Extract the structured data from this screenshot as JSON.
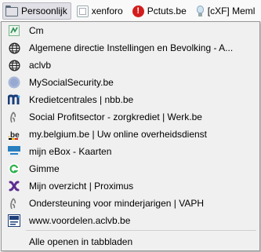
{
  "toolbar": {
    "items": [
      {
        "label": "Persoonlijk",
        "icon": "folder-icon",
        "active": true
      },
      {
        "label": "xenforo",
        "icon": "folder-icon"
      },
      {
        "label": "Pctuts.be",
        "icon": "pctuts-icon"
      },
      {
        "label": "[cXF] Meml",
        "icon": "bulb-icon"
      }
    ]
  },
  "menu": {
    "items": [
      {
        "label": "Cm",
        "icon": "cm-icon"
      },
      {
        "label": "Algemene directie Instellingen en Bevolking -  A...",
        "icon": "globe-icon"
      },
      {
        "label": "aclvb",
        "icon": "globe-icon"
      },
      {
        "label": "MySocialSecurity.be",
        "icon": "mysocialsecurity-icon"
      },
      {
        "label": "Kredietcentrales | nbb.be",
        "icon": "nbb-icon"
      },
      {
        "label": "Social Profitsector - zorgkrediet | Werk.be",
        "icon": "werk-icon"
      },
      {
        "label": "my.belgium.be | Uw online overheidsdienst",
        "icon": "belgium-be-icon"
      },
      {
        "label": "mijn eBox - Kaarten",
        "icon": "ebox-icon"
      },
      {
        "label": "Gimme",
        "icon": "gimme-icon"
      },
      {
        "label": "Mijn overzicht | Proximus",
        "icon": "proximus-icon"
      },
      {
        "label": "Ondersteuning voor minderjarigen | VAPH",
        "icon": "vaph-icon"
      },
      {
        "label": "www.voordelen.aclvb.be",
        "icon": "aclvb-voordelen-icon"
      }
    ],
    "open_all_label": "Alle openen in tabbladen"
  },
  "colors": {
    "menu_bg": "#f0f0f0",
    "proximus": "#5c2d91",
    "nbb": "#1a3d7a",
    "gimme": "#2bb24c",
    "belgium_be": "#e4b100"
  }
}
